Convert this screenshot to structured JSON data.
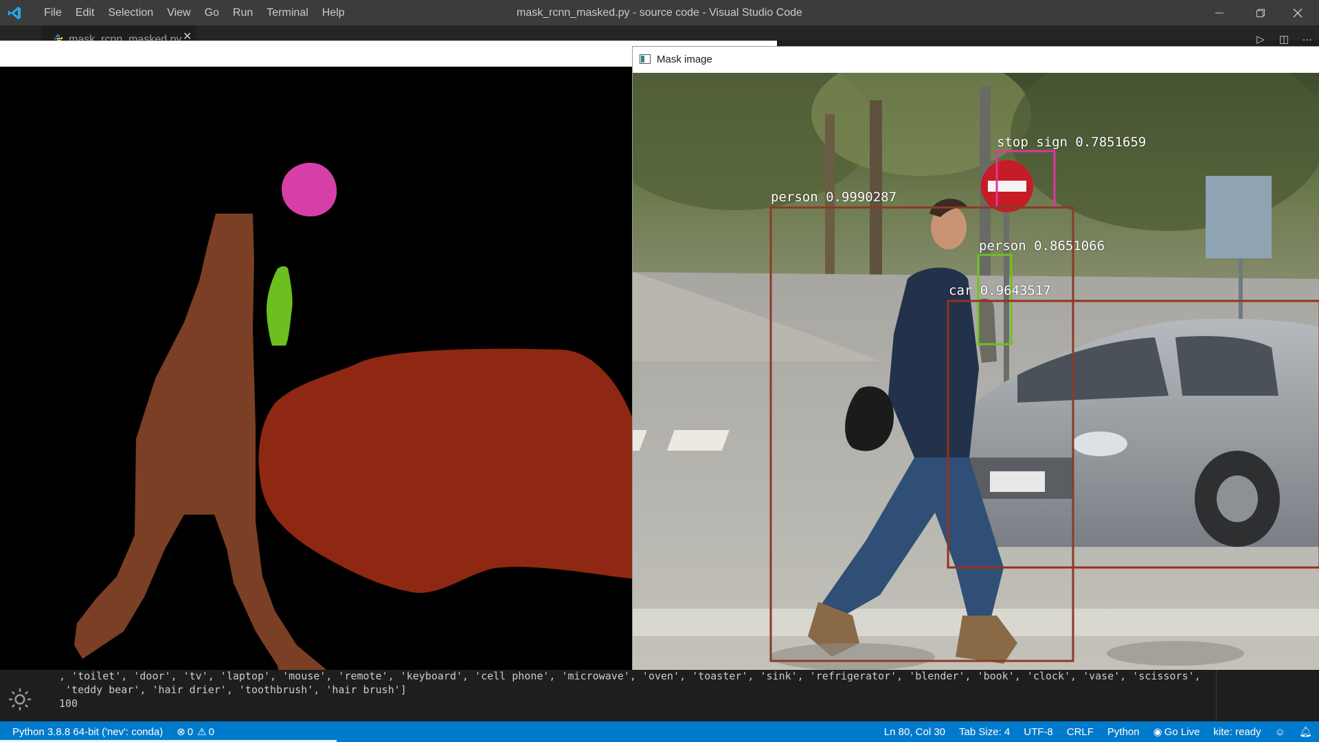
{
  "vscode": {
    "menu": [
      "File",
      "Edit",
      "Selection",
      "View",
      "Go",
      "Run",
      "Terminal",
      "Help"
    ],
    "window_title": "mask_rcnn_masked.py - source code - Visual Studio Code",
    "tab_label": "mask_rcnn_masked.py",
    "accent_color": "#007acc"
  },
  "mask_window": {
    "title": "Mask image",
    "mask_colors": {
      "person": "#7a3f24",
      "car": "#8e2812",
      "person_small": "#6cbf1e",
      "stop_sign": "#d63fa8"
    },
    "detections": [
      {
        "label": "stop sign 0.7851659",
        "color": "#e0359e"
      },
      {
        "label": "person 0.9990287",
        "color": "#8a3b25"
      },
      {
        "label": "person 0.8651066",
        "color": "#6fc21d"
      },
      {
        "label": "car 0.9643517",
        "color": "#99301a"
      }
    ]
  },
  "terminal": {
    "line1": ", 'toilet', 'door', 'tv', 'laptop', 'mouse', 'remote', 'keyboard', 'cell phone', 'microwave', 'oven', 'toaster', 'sink', 'refrigerator', 'blender', 'book', 'clock', 'vase', 'scissors',",
    "line2": " 'teddy bear', 'hair drier', 'toothbrush', 'hair brush']",
    "line3": "100"
  },
  "statusbar": {
    "interpreter": "Python 3.8.8 64-bit ('nev': conda)",
    "errors": "0",
    "warnings": "0",
    "cursor": "Ln 80, Col 30",
    "tab_size": "Tab Size: 4",
    "encoding": "UTF-8",
    "eol": "CRLF",
    "language": "Python",
    "go_live": "Go Live",
    "kite": "kite: ready"
  }
}
